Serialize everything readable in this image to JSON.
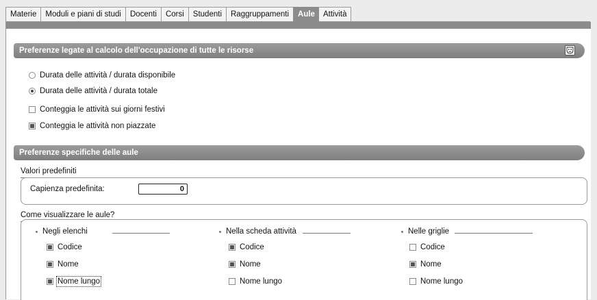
{
  "tabs": [
    {
      "label": "Materie"
    },
    {
      "label": "Moduli e piani di studi"
    },
    {
      "label": "Docenti"
    },
    {
      "label": "Corsi"
    },
    {
      "label": "Studenti"
    },
    {
      "label": "Raggruppamenti"
    },
    {
      "label": "Aule",
      "active": true
    },
    {
      "label": "Attività"
    }
  ],
  "section1": {
    "title": "Preferenze legate al calcolo dell'occupazione di tutte le risorse",
    "icon": "mask-icon",
    "radio1": {
      "label": "Durata delle attività / durata disponibile",
      "checked": false
    },
    "radio2": {
      "label": "Durata delle attività / durata totale",
      "checked": true
    },
    "check1": {
      "label": "Conteggia le attività sui giorni festivi",
      "checked": false
    },
    "check2": {
      "label": "Conteggia le attività non piazzate",
      "checked": true
    }
  },
  "section2": {
    "title": "Preferenze specifiche delle aule",
    "defaults": {
      "group_title": "Valori predefiniti",
      "capacity_label": "Capienza predefinita:",
      "capacity_value": "0"
    },
    "display": {
      "group_title": "Come visualizzare le aule?",
      "columns": [
        {
          "title": "Negli elenchi",
          "codice": true,
          "nome": true,
          "nome_lungo": true
        },
        {
          "title": "Nella scheda attività",
          "codice": true,
          "nome": true,
          "nome_lungo": false
        },
        {
          "title": "Nelle griglie",
          "codice": false,
          "nome": true,
          "nome_lungo": false
        }
      ],
      "labels": {
        "codice": "Codice",
        "nome": "Nome",
        "nome_lungo": "Nome lungo"
      }
    }
  }
}
